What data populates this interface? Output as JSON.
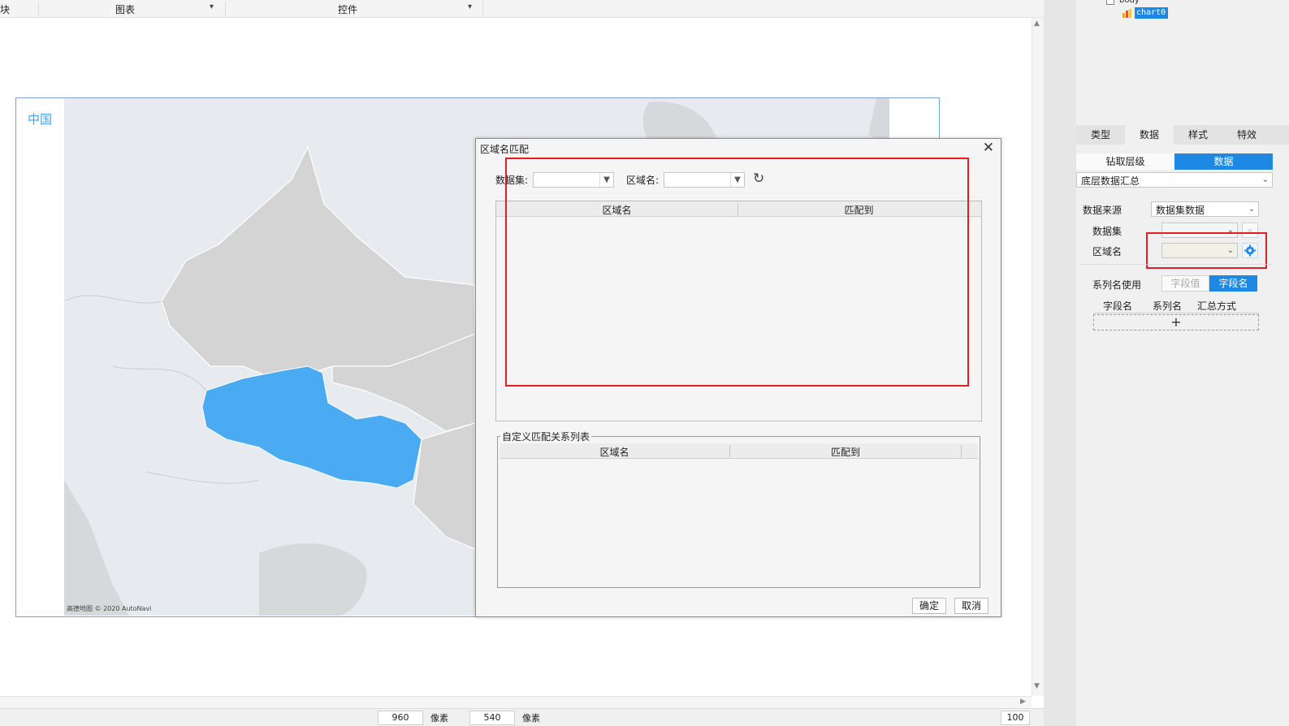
{
  "toolbar": {
    "block_label": "块",
    "chart_label": "图表",
    "widget_label": "控件"
  },
  "chart": {
    "title": "中国",
    "credit": "高德地图 © 2020 AutoNavi"
  },
  "dialog": {
    "title": "区域名匹配",
    "close_label": "✕",
    "dataset_label": "数据集:",
    "region_label": "区域名:",
    "refresh_label": "↻",
    "table1": {
      "col_region": "区域名",
      "col_match": "匹配到"
    },
    "custom_group_title": "自定义匹配关系列表",
    "table2": {
      "col_region": "区域名",
      "col_match": "匹配到"
    },
    "ok_label": "确定",
    "cancel_label": "取消"
  },
  "status": {
    "width": "960",
    "width_unit": "像素",
    "height": "540",
    "height_unit": "像素",
    "zoom": "100"
  },
  "right_panel": {
    "tree_body": "body",
    "tree_chart": "chart0",
    "tabs": [
      "类型",
      "数据",
      "样式",
      "特效"
    ],
    "subtabs": [
      "钻取层级",
      "数据"
    ],
    "level_select": "底层数据汇总",
    "data_source_label": "数据来源",
    "data_source_value": "数据集数据",
    "dataset_label": "数据集",
    "region_label": "区域名",
    "series_label": "系列名使用",
    "toggle": [
      "字段值",
      "字段名"
    ],
    "columns": [
      "字段名",
      "系列名",
      "汇总方式"
    ],
    "add_label": "+"
  },
  "colors": {
    "highlight_region": "#4aabf2",
    "land": "#d3d3d3",
    "accent": "#1e88e5",
    "annotation": "#e02020"
  }
}
